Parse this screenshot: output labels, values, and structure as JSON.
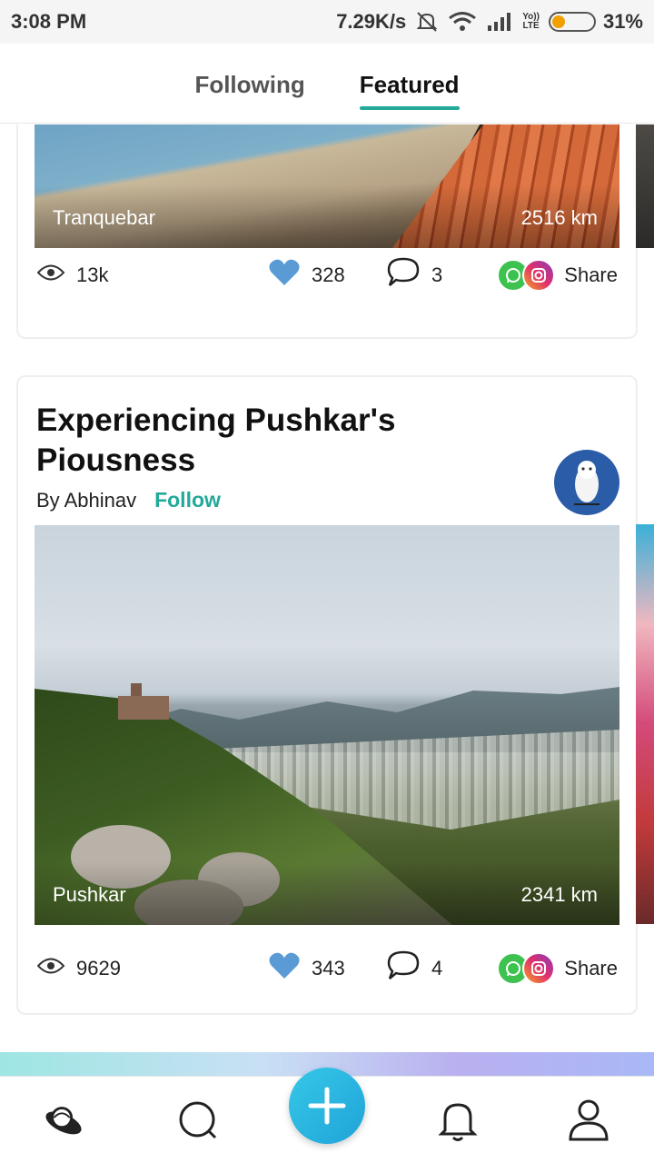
{
  "status_bar": {
    "time": "3:08 PM",
    "network_speed": "7.29K/s",
    "volte_label_top": "Yo))",
    "volte_label_bottom": "LTE",
    "battery_percent": "31%",
    "battery_level": 0.31,
    "icons": [
      "mute-icon",
      "wifi-icon",
      "signal-icon",
      "battery-icon"
    ]
  },
  "tabs": [
    {
      "label": "Following",
      "active": false
    },
    {
      "label": "Featured",
      "active": true
    }
  ],
  "accent_color": "#22a99a",
  "posts": [
    {
      "location": "Tranquebar",
      "distance": "2516 km",
      "views": "13k",
      "likes": "328",
      "comments": "3",
      "share_label": "Share"
    },
    {
      "title": "Experiencing Pushkar's Piousness",
      "author": "By Abhinav",
      "follow_label": "Follow",
      "location": "Pushkar",
      "distance": "2341 km",
      "views": "9629",
      "likes": "343",
      "comments": "4",
      "share_label": "Share"
    }
  ],
  "bottom_nav": {
    "items": [
      "explore-icon",
      "search-icon",
      "add-icon",
      "bell-icon",
      "profile-icon"
    ]
  }
}
